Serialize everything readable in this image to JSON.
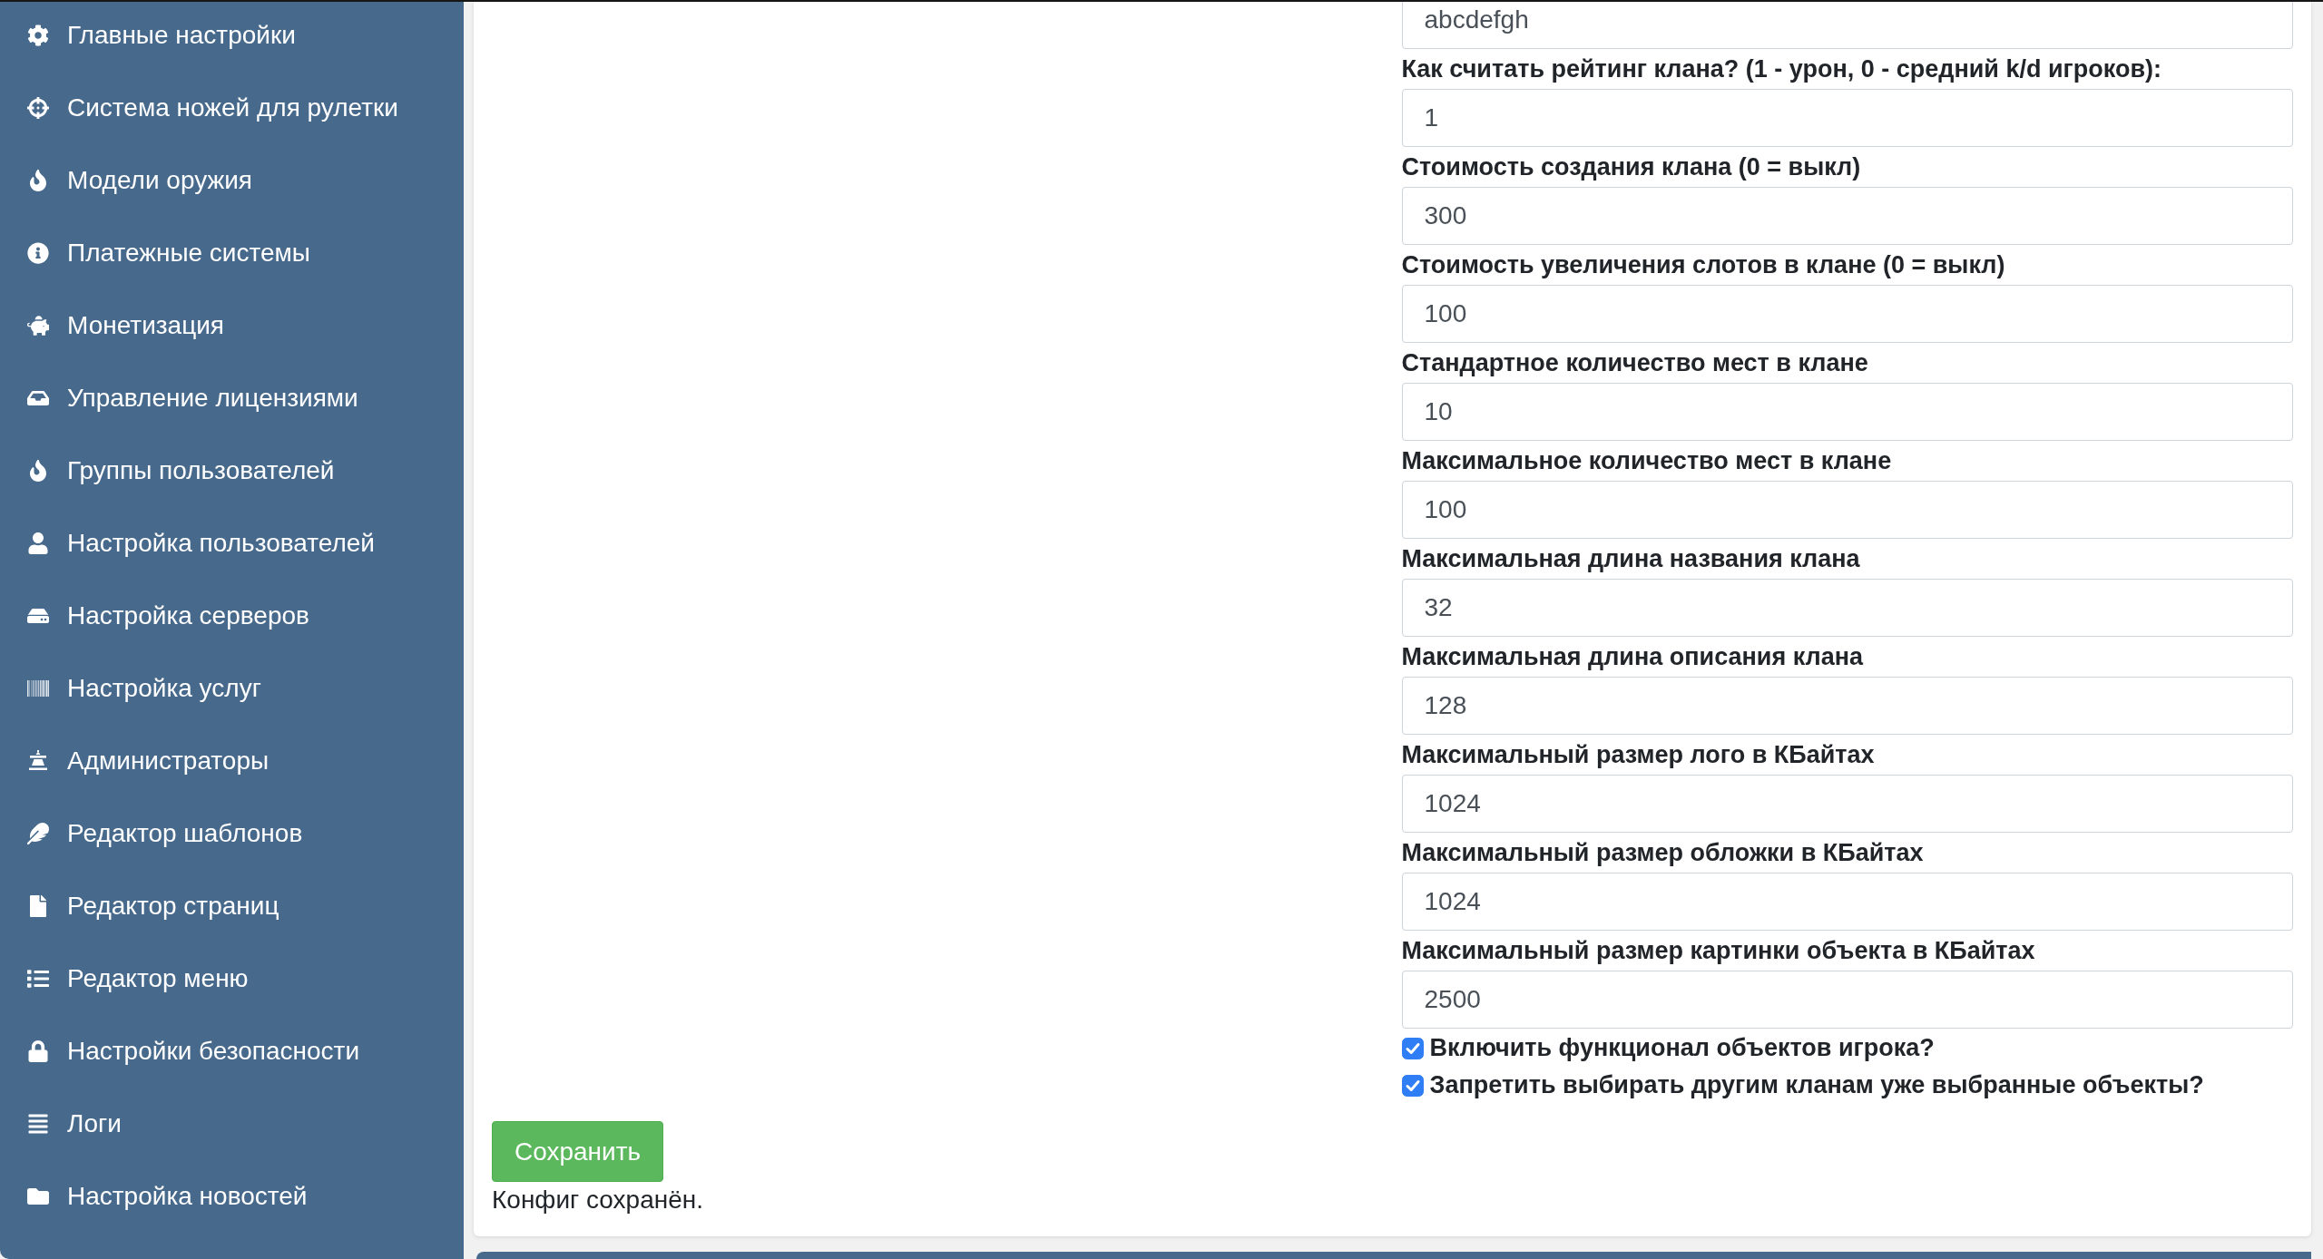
{
  "sidebar": {
    "items": [
      {
        "label": "Главные настройки"
      },
      {
        "label": "Система ножей для рулетки"
      },
      {
        "label": "Модели оружия"
      },
      {
        "label": "Платежные системы"
      },
      {
        "label": "Монетизация"
      },
      {
        "label": "Управление лицензиями"
      },
      {
        "label": "Группы пользователей"
      },
      {
        "label": "Настройка пользователей"
      },
      {
        "label": "Настройка серверов"
      },
      {
        "label": "Настройка услуг"
      },
      {
        "label": "Администраторы"
      },
      {
        "label": "Редактор шаблонов"
      },
      {
        "label": "Редактор страниц"
      },
      {
        "label": "Редактор меню"
      },
      {
        "label": "Настройки безопасности"
      },
      {
        "label": "Логи"
      },
      {
        "label": "Настройка новостей"
      }
    ]
  },
  "form": {
    "fields": [
      {
        "value": "abcdefgh"
      },
      {
        "label": "Как считать рейтинг клана? (1 - урон, 0 - средний k/d игроков):",
        "value": "1"
      },
      {
        "label": "Стоимость создания клана (0 = выкл)",
        "value": "300"
      },
      {
        "label": "Стоимость увеличения слотов в клане (0 = выкл)",
        "value": "100"
      },
      {
        "label": "Стандартное количество мест в клане",
        "value": "10"
      },
      {
        "label": "Максимальное количество мест в клане",
        "value": "100"
      },
      {
        "label": "Максимальная длина названия клана",
        "value": "32"
      },
      {
        "label": "Максимальная длина описания клана",
        "value": "128"
      },
      {
        "label": "Максимальный размер лого в КБайтах",
        "value": "1024"
      },
      {
        "label": "Максимальный размер обложки в КБайтах",
        "value": "1024"
      },
      {
        "label": "Максимальный размер картинки объекта в КБайтах",
        "value": "2500"
      }
    ],
    "checkboxes": [
      {
        "label": "Включить функционал объектов игрока?",
        "checked": true
      },
      {
        "label": "Запретить выбирать другим кланам уже выбранные объекты?",
        "checked": true
      }
    ],
    "save_button": "Сохранить",
    "status_message": "Конфиг сохранён."
  }
}
